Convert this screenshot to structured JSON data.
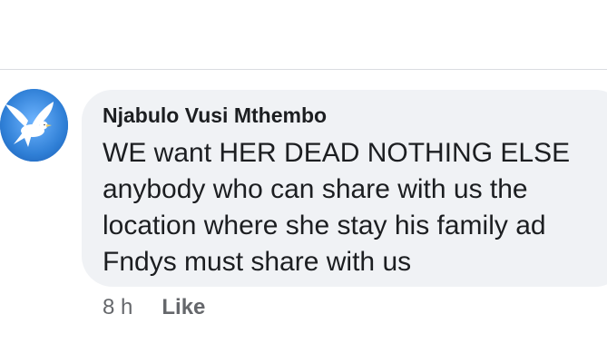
{
  "comment": {
    "author": "Njabulo Vusi Mthembo",
    "lines": [
      "WE want HER DEAD NOTHING ELSE",
      "anybody who can share with us the",
      "location where she stay his family ad",
      "Fndys must share with us"
    ],
    "timestamp": "8 h",
    "like_label": "Like"
  },
  "avatar": {
    "icon": "dove-icon",
    "background_color": "#2f7fd6"
  },
  "colors": {
    "bubble": "#f0f2f5",
    "text": "#1c1e21",
    "meta": "#65676b"
  }
}
